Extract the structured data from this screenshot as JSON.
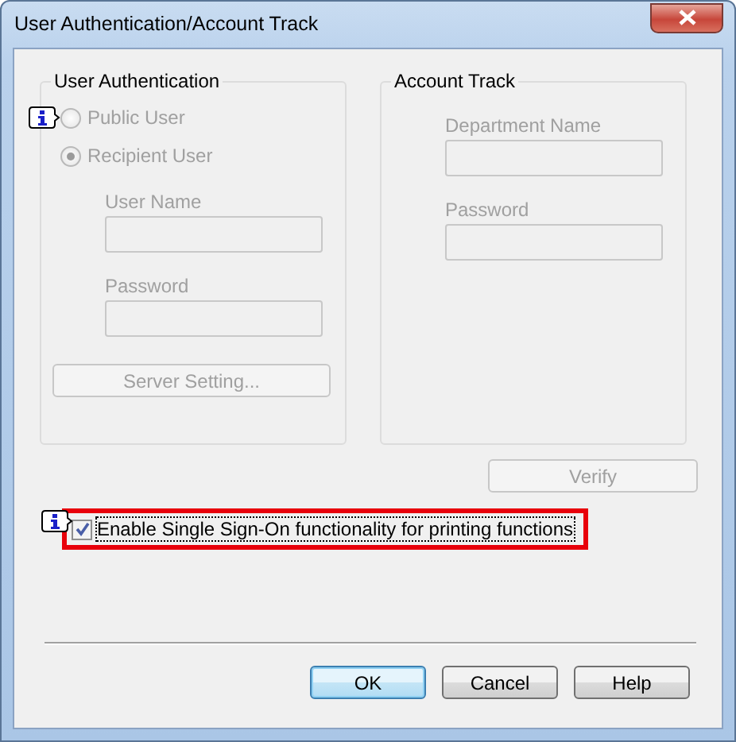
{
  "window": {
    "title": "User Authentication/Account Track"
  },
  "user_authentication": {
    "title": "User Authentication",
    "disabled": true,
    "options": [
      {
        "label": "Public User",
        "selected": false,
        "info": true
      },
      {
        "label": "Recipient User",
        "selected": true,
        "info": false
      }
    ],
    "fields": [
      {
        "label": "User Name"
      },
      {
        "label": "Password"
      }
    ],
    "button": "Server Setting..."
  },
  "account_track": {
    "title": "Account Track",
    "disabled": true,
    "fields": [
      {
        "label": "Department Name"
      },
      {
        "label": "Password"
      }
    ],
    "button": "Verify"
  },
  "sso_checkbox": {
    "label": "Enable Single Sign-On functionality for printing functions",
    "checked": true,
    "info": true,
    "highlighted": true
  },
  "buttons": [
    {
      "label": "OK",
      "default": true
    },
    {
      "label": "Cancel",
      "default": false
    },
    {
      "label": "Help",
      "default": false
    }
  ]
}
